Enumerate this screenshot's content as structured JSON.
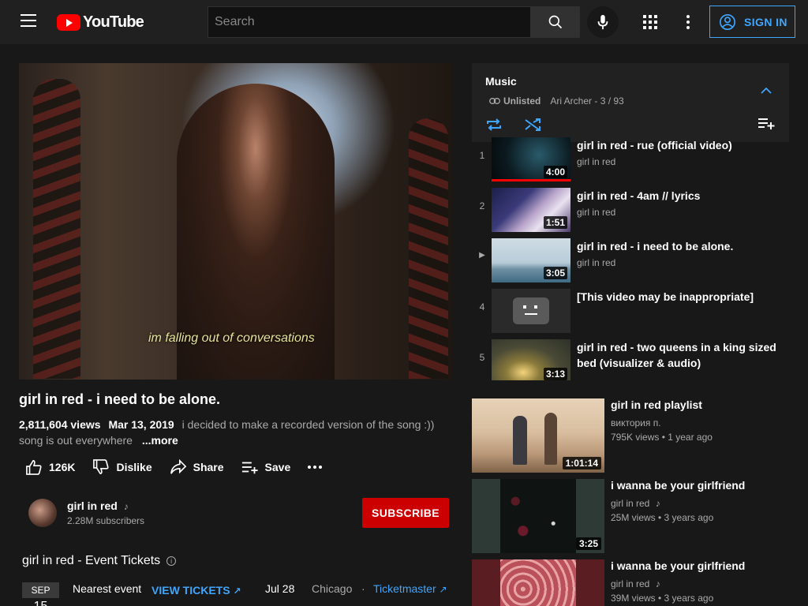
{
  "header": {
    "logo_text": "YouTube",
    "search_placeholder": "Search",
    "signin_label": "SIGN IN",
    "accent": "#3ea6ff"
  },
  "video": {
    "caption": "im falling out of conversations",
    "title": "girl in red - i need to be alone.",
    "views": "2,811,604 views",
    "date": "Mar 13, 2019",
    "desc1": "i decided to make a recorded version of the song :))",
    "desc2": "song is out everywhere",
    "more": "...more",
    "like_count": "126K",
    "dislike_label": "Dislike",
    "share_label": "Share",
    "save_label": "Save"
  },
  "channel": {
    "name": "girl in red",
    "subscribers": "2.28M subscribers",
    "subscribe_label": "SUBSCRIBE",
    "subscribe_color": "#cc0000"
  },
  "event": {
    "heading": "girl in red - Event Tickets",
    "month": "SEP",
    "day": "15",
    "title": "Nearest event",
    "button": "VIEW TICKETS",
    "date": "Jul 28",
    "city": "Chicago",
    "vendor": "Ticketmaster"
  },
  "playlist": {
    "title": "Music",
    "visibility": "Unlisted",
    "owner_position": "Ari Archer - 3 / 93",
    "items": [
      {
        "index": "1",
        "title": "girl in red - rue (official video)",
        "channel": "girl in red",
        "duration": "4:00",
        "watched": 1.0
      },
      {
        "index": "2",
        "title": "girl in red - 4am // lyrics",
        "channel": "girl in red",
        "duration": "1:51",
        "watched": 0
      },
      {
        "index": "▶",
        "title": "girl in red - i need to be alone.",
        "channel": "girl in red",
        "duration": "3:05",
        "watched": 0
      },
      {
        "index": "4",
        "title": "[This video may be inappropriate]",
        "channel": "",
        "duration": "",
        "watched": 0
      },
      {
        "index": "5",
        "title": "girl in red - two queens in a king sized bed (visualizer & audio)",
        "channel": "girl in red",
        "duration": "3:13",
        "watched": 0
      }
    ]
  },
  "recommendations": [
    {
      "title": "girl in red playlist",
      "channel": "виктория п.",
      "stats": "795K views • 1 year ago",
      "duration": "1:01:14"
    },
    {
      "title": "i wanna be your girlfriend",
      "channel": "girl in red",
      "stats": "25M views • 3 years ago",
      "duration": "3:25"
    },
    {
      "title": "i wanna be your girlfriend",
      "channel": "girl in red",
      "stats": "39M views • 3 years ago",
      "duration": ""
    }
  ]
}
